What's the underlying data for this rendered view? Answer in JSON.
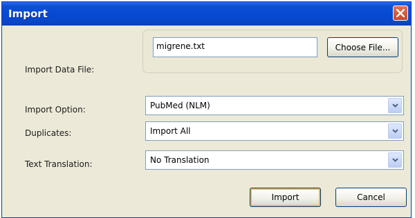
{
  "window": {
    "title": "Import"
  },
  "labels": {
    "import_data_file": "Import Data File:",
    "import_option": "Import Option:",
    "duplicates": "Duplicates:",
    "text_translation": "Text Translation:"
  },
  "file": {
    "value": "migrene.txt",
    "choose_label": "Choose File..."
  },
  "selects": {
    "import_option": "PubMed (NLM)",
    "duplicates": "Import All",
    "text_translation": "No Translation"
  },
  "buttons": {
    "import": "Import",
    "cancel": "Cancel"
  },
  "icons": {
    "close": "close-icon",
    "dropdown": "chevron-down-icon"
  },
  "colors": {
    "titlebar": "#0a4fd6",
    "close": "#d8593a",
    "dialog_bg": "#ece9d8",
    "default_button_focus": "#f5b44a"
  }
}
